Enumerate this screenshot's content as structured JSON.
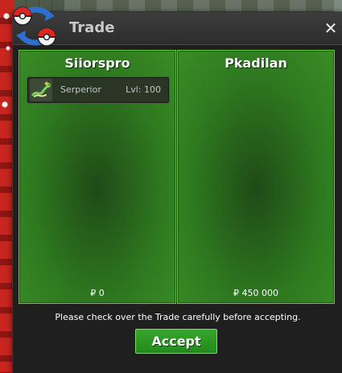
{
  "window": {
    "title": "Trade",
    "close_label": "✕",
    "logo_icon": "trade-swap-pokeballs-icon"
  },
  "trade": {
    "left": {
      "trainer": "Siiorspro",
      "items": [
        {
          "icon": "serperior-icon",
          "name": "Serperior",
          "level": "Lvl: 100"
        }
      ],
      "money": "₽ 0"
    },
    "right": {
      "trainer": "Pkadilan",
      "items": [],
      "money": "₽ 450 000"
    }
  },
  "notice": "Please check over the Trade carefully before accepting.",
  "accept_label": "Accept",
  "colors": {
    "panel_border": "#66cc33",
    "panel_fill": "#2f7a20",
    "accept_fill": "#2a9a22",
    "window_bg": "#1f1f1f"
  }
}
